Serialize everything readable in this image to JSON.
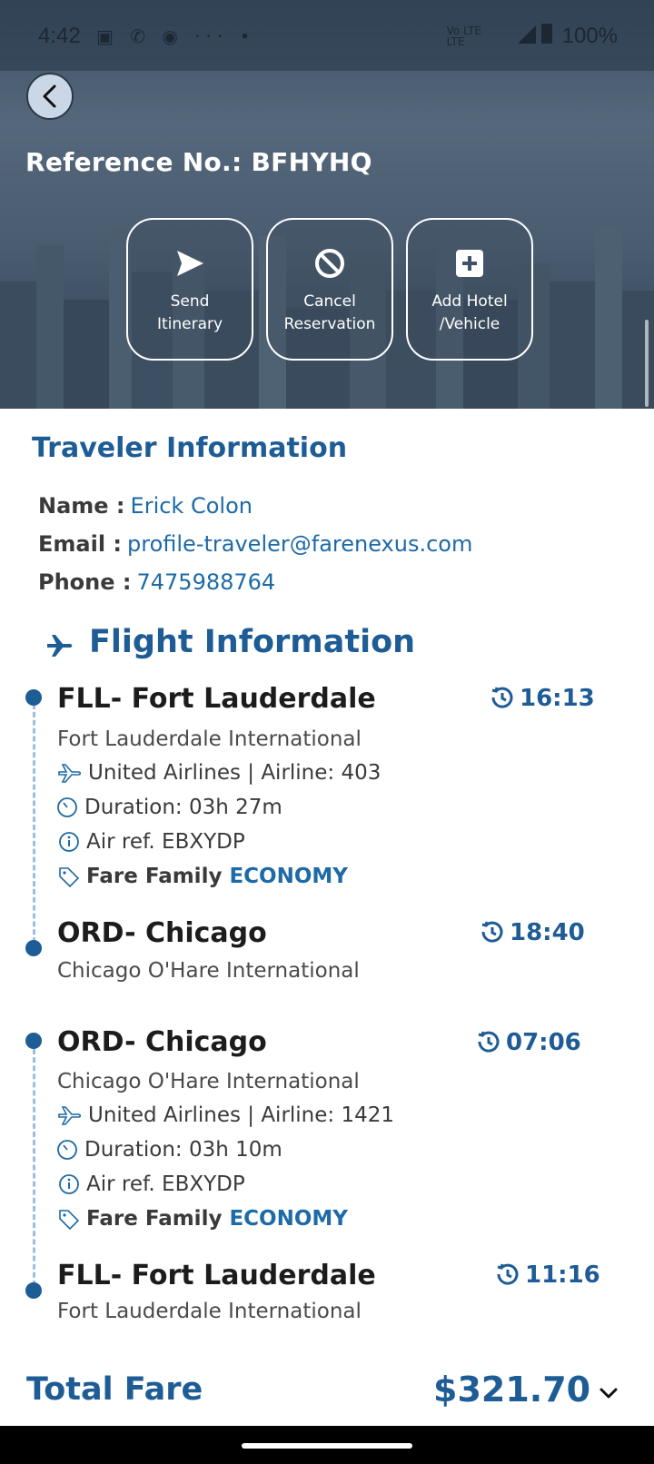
{
  "status_bar": {
    "time": "4:42",
    "network": "Vo LTE",
    "network_sub": "LTE",
    "battery": "100%"
  },
  "header": {
    "reference": "Reference No.: BFHYHQ"
  },
  "actions": [
    {
      "label": "Send\nItinerary",
      "icon": "send-icon"
    },
    {
      "label": "Cancel\nReservation",
      "icon": "cancel-icon"
    },
    {
      "label": "Add Hotel\n/Vehicle",
      "icon": "add-icon"
    }
  ],
  "traveler": {
    "title": "Traveler Information",
    "name_label": "Name :",
    "name": "Erick Colon",
    "email_label": "Email :",
    "email": "profile-traveler@farenexus.com",
    "phone_label": "Phone :",
    "phone": "7475988764"
  },
  "flight": {
    "title": "Flight Information",
    "segments": [
      {
        "from_code": "FLL- Fort Lauderdale",
        "from_airport": "Fort Lauderdale International",
        "dep_time": "16:13",
        "airline": "United Airlines | Airline: 403",
        "duration": "Duration: 03h 27m",
        "air_ref": "Air ref. EBXYDP",
        "fare_family_label": "Fare Family",
        "fare_family": "ECONOMY",
        "to_code": "ORD- Chicago",
        "to_airport": "Chicago O'Hare International",
        "arr_time": "18:40"
      },
      {
        "from_code": "ORD- Chicago",
        "from_airport": "Chicago O'Hare International",
        "dep_time": "07:06",
        "airline": "United Airlines | Airline: 1421",
        "duration": "Duration: 03h 10m",
        "air_ref": "Air ref. EBXYDP",
        "fare_family_label": "Fare Family",
        "fare_family": "ECONOMY",
        "to_code": "FLL- Fort Lauderdale",
        "to_airport": "Fort Lauderdale International",
        "arr_time": "11:16"
      }
    ]
  },
  "total": {
    "label": "Total Fare",
    "value": "$321.70"
  },
  "colors": {
    "accent": "#1e5c96",
    "link": "#1e6aa6"
  }
}
